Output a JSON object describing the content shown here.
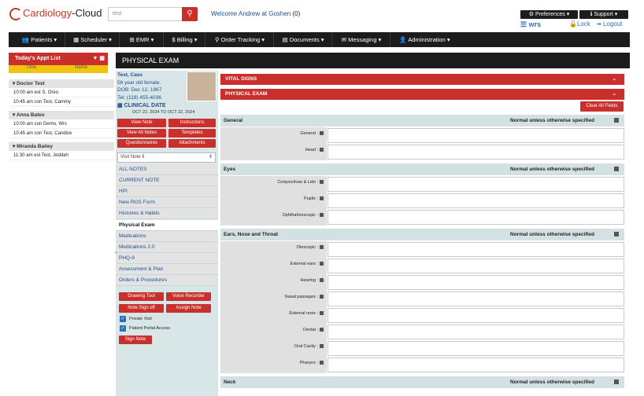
{
  "header": {
    "logo_text_a": "Cardiology",
    "logo_text_b": "-Cloud",
    "search_value": "test",
    "welcome_text": "Welcome Andrew at Goshen",
    "message_count": "(0)",
    "preferences_label": "Preferences ▾",
    "support_label": "Support ▾",
    "wrs_label": "wrs",
    "lock_label": "Lock",
    "logout_label": "Logout"
  },
  "nav": [
    {
      "label": "Patients ▾"
    },
    {
      "label": "Scheduler ▾"
    },
    {
      "label": "EMR ▾"
    },
    {
      "label": "Billing ▾"
    },
    {
      "label": "Order Tracking ▾"
    },
    {
      "label": "Documents ▾"
    },
    {
      "label": "Messaging ▾"
    },
    {
      "label": "Administration ▾"
    }
  ],
  "appts": {
    "title": "Today's Appt List",
    "col_time": "Time",
    "col_name": "Name",
    "groups": [
      {
        "doctor": "Doctor Test",
        "items": [
          "10:00 am est  S, Oreo",
          "10:45 am con  Test, Cammy"
        ]
      },
      {
        "doctor": "Anna Bates",
        "items": [
          "10:00 am con  Demo, Wrs",
          "10:45 am con  Test, Candice"
        ]
      },
      {
        "doctor": "Miranda Bailey",
        "items": [
          "11:30 am est  Test, Jeddah"
        ]
      }
    ]
  },
  "page_title": "PHYSICAL EXAM",
  "patient": {
    "name": "Test, Cass",
    "age": "56 year old female.",
    "dob": "DOB: Dec 12, 1967",
    "tel": "Tel: (118) 455-4036",
    "clinical_date_label": "CLINICAL DATE",
    "clinical_date_range": "OCT 22, 2024 TO OCT 22, 2024"
  },
  "buttons": {
    "view_note": "View Note",
    "instructions": "Instructions",
    "view_all_notes": "View All Notes",
    "templates": "Templates",
    "questionnaires": "Questionnaires",
    "attachments": "Attachments",
    "drawing_tool": "Drawing Tool",
    "voice_recorder": "Voice Recorder",
    "note_sign_off": "Note Sign off",
    "assign_note": "Assign Note",
    "sign_note": "Sign Note",
    "clear_all": "Clear All Fields"
  },
  "visit_select": "Visit Note II",
  "menu": [
    "ALL NOTES",
    "CURRENT NOTE",
    "HPI",
    "New ROS Form",
    "Histories & Habits",
    "Physical Exam",
    "Medications",
    "Medications 2.0",
    "PHQ-9",
    "Assessment & Plan",
    "Orders & Procedures"
  ],
  "checkboxes": {
    "private_visit": "Private Visit",
    "patient_portal": "Patient Portal Access"
  },
  "sections": {
    "vital_signs": "VITAL SIGNS",
    "physical_exam": "PHYSICAL EXAM"
  },
  "normal_text": "Normal unless otherwise specified",
  "groups": [
    {
      "title": "General",
      "fields": [
        "General :",
        "Head :"
      ]
    },
    {
      "title": "Eyes",
      "fields": [
        "Conjunctivae & Lids :",
        "Pupils :",
        "Ophthalmoscopic :"
      ]
    },
    {
      "title": "Ears, Nose and Throat",
      "fields": [
        "Otoscopic :",
        "External ears :",
        "Hearing :",
        "Nasal passages :",
        "External nose :",
        "Dental :",
        "Oral Cavity :",
        "Pharynx :"
      ]
    },
    {
      "title": "Neck",
      "fields": []
    }
  ]
}
